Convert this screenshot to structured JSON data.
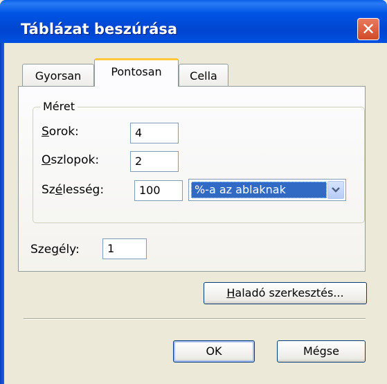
{
  "window": {
    "title": "Táblázat beszúrása",
    "close_glyph": "✕"
  },
  "tabs": [
    {
      "label": "Gyorsan"
    },
    {
      "label": "Pontosan"
    },
    {
      "label": "Cella"
    }
  ],
  "size_group": {
    "legend": "Méret",
    "rows": {
      "label_mnemonic": "S",
      "label_rest": "orok:",
      "value": "4"
    },
    "columns": {
      "label_mnemonic": "O",
      "label_rest": "szlopok:",
      "value": "2"
    },
    "width": {
      "label_pre": "Sz",
      "label_mnemonic": "é",
      "label_rest": "lesség:",
      "value": "100",
      "unit_selected": "%-a az ablaknak"
    }
  },
  "border": {
    "label_pre": "Sze",
    "label_mnemonic": "g",
    "label_rest": "ély:",
    "value": "1"
  },
  "buttons": {
    "advanced_mnemonic": "H",
    "advanced_rest": "aladó szerkesztés...",
    "ok": "OK",
    "cancel": "Mégse"
  }
}
